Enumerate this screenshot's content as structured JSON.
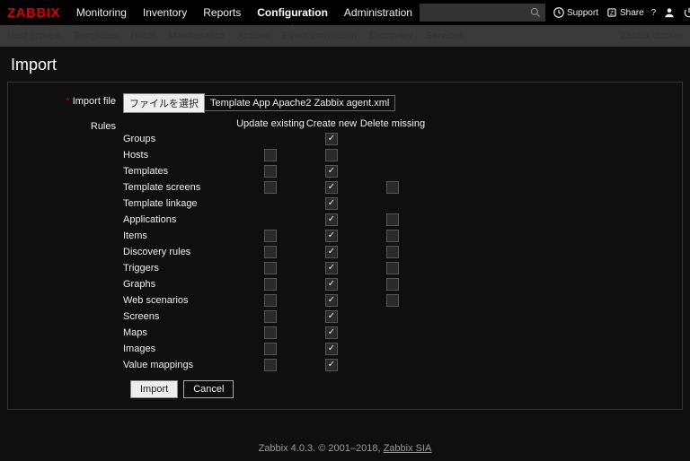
{
  "logo": "ZABBIX",
  "nav": [
    "Monitoring",
    "Inventory",
    "Reports",
    "Configuration",
    "Administration"
  ],
  "nav_active": 3,
  "top_right": {
    "support": "Support",
    "share": "Share"
  },
  "subnav": [
    "Host groups",
    "Templates",
    "Hosts",
    "Maintenance",
    "Actions",
    "Event correlation",
    "Discovery",
    "Services"
  ],
  "subnav_right": "Zabbix docker",
  "title": "Import",
  "import_file": {
    "label": "Import file",
    "button": "ファイルを選択",
    "filename": "Template App Apache2 Zabbix agent.xml"
  },
  "rules": {
    "label": "Rules",
    "headers": [
      "Update existing",
      "Create new",
      "Delete missing"
    ],
    "rows": [
      {
        "name": "Groups",
        "cells": [
          null,
          true,
          null
        ]
      },
      {
        "name": "Hosts",
        "cells": [
          false,
          false,
          null
        ]
      },
      {
        "name": "Templates",
        "cells": [
          false,
          true,
          null
        ]
      },
      {
        "name": "Template screens",
        "cells": [
          false,
          true,
          false
        ]
      },
      {
        "name": "Template linkage",
        "cells": [
          null,
          true,
          null
        ]
      },
      {
        "name": "Applications",
        "cells": [
          null,
          true,
          false
        ]
      },
      {
        "name": "Items",
        "cells": [
          false,
          true,
          false
        ]
      },
      {
        "name": "Discovery rules",
        "cells": [
          false,
          true,
          false
        ]
      },
      {
        "name": "Triggers",
        "cells": [
          false,
          true,
          false
        ]
      },
      {
        "name": "Graphs",
        "cells": [
          false,
          true,
          false
        ]
      },
      {
        "name": "Web scenarios",
        "cells": [
          false,
          true,
          false
        ]
      },
      {
        "name": "Screens",
        "cells": [
          false,
          true,
          null
        ]
      },
      {
        "name": "Maps",
        "cells": [
          false,
          true,
          null
        ]
      },
      {
        "name": "Images",
        "cells": [
          false,
          true,
          null
        ]
      },
      {
        "name": "Value mappings",
        "cells": [
          false,
          true,
          null
        ]
      }
    ]
  },
  "buttons": {
    "import": "Import",
    "cancel": "Cancel"
  },
  "footer": {
    "text": "Zabbix 4.0.3. © 2001–2018, ",
    "link": "Zabbix SIA"
  }
}
